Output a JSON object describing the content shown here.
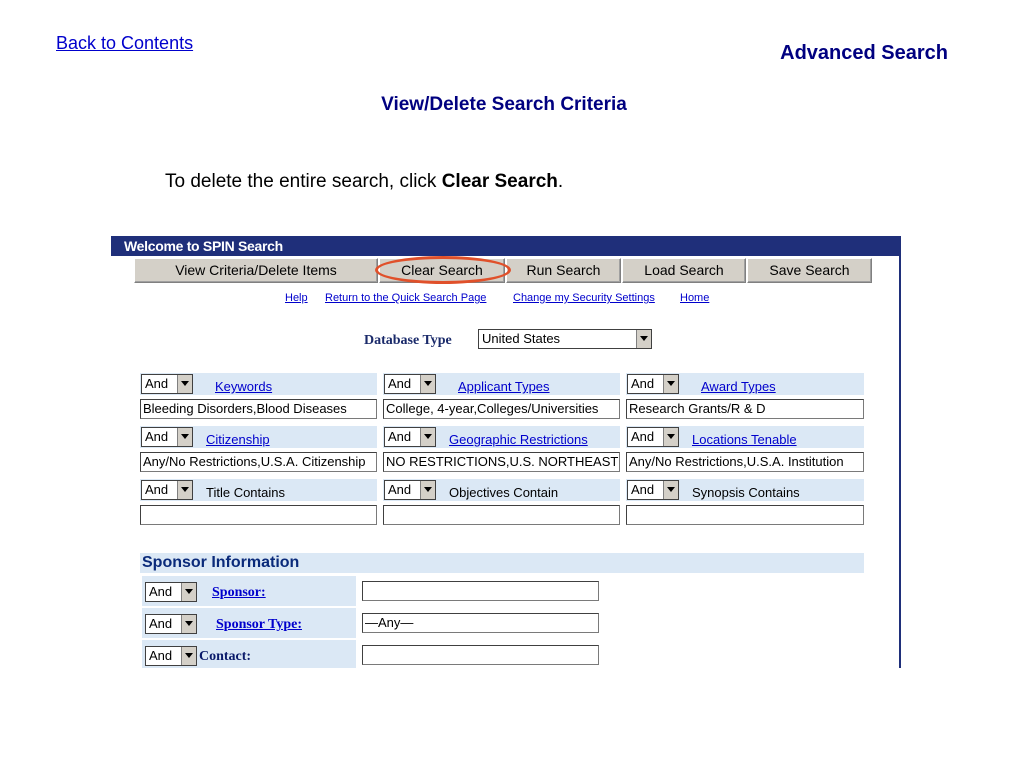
{
  "nav": {
    "back_label": "Back to Contents"
  },
  "slide": {
    "title": "Advanced Search",
    "section_title": "View/Delete Search Criteria",
    "instruction_prefix": "To delete the entire search, click ",
    "instruction_bold": "Clear Search",
    "instruction_suffix": "."
  },
  "app": {
    "welcome": "Welcome to SPIN Search",
    "tabs": [
      "View Criteria/Delete Items",
      "Clear Search",
      "Run Search",
      "Load Search",
      "Save Search"
    ],
    "links": [
      "Help",
      "Return to the Quick Search Page",
      "Change my Security Settings",
      "Home"
    ],
    "db_label": "Database Type",
    "db_value": "United States",
    "criteria": [
      {
        "op": "And",
        "label": "Keywords",
        "link": true,
        "value": "Bleeding Disorders,Blood Diseases"
      },
      {
        "op": "And",
        "label": "Applicant Types",
        "link": true,
        "value": "College, 4-year,Colleges/Universities"
      },
      {
        "op": "And",
        "label": "Award Types",
        "link": true,
        "value": "Research Grants/R & D"
      },
      {
        "op": "And",
        "label": "Citizenship",
        "link": true,
        "value": "Any/No Restrictions,U.S.A. Citizenship"
      },
      {
        "op": "And",
        "label": "Geographic Restrictions",
        "link": true,
        "value": "NO RESTRICTIONS,U.S. NORTHEAST"
      },
      {
        "op": "And",
        "label": "Locations Tenable",
        "link": true,
        "value": "Any/No Restrictions,U.S.A. Institution"
      },
      {
        "op": "And",
        "label": "Title Contains",
        "link": false,
        "value": ""
      },
      {
        "op": "And",
        "label": "Objectives Contain",
        "link": false,
        "value": ""
      },
      {
        "op": "And",
        "label": "Synopsis Contains",
        "link": false,
        "value": ""
      }
    ],
    "sponsor_header": "Sponsor Information",
    "sponsor_rows": [
      {
        "op": "And",
        "label": "Sponsor:",
        "link": true,
        "value": ""
      },
      {
        "op": "And",
        "label": "Sponsor Type:",
        "link": true,
        "value": "—Any—"
      },
      {
        "op": "And",
        "label": "Contact:",
        "link": false,
        "value": ""
      }
    ]
  },
  "colors": {
    "title_navy": "#000080",
    "link_blue": "#0000cc",
    "header_bar": "#1f2f7a",
    "band": "#dbe8f5",
    "highlight": "#e0502a"
  }
}
